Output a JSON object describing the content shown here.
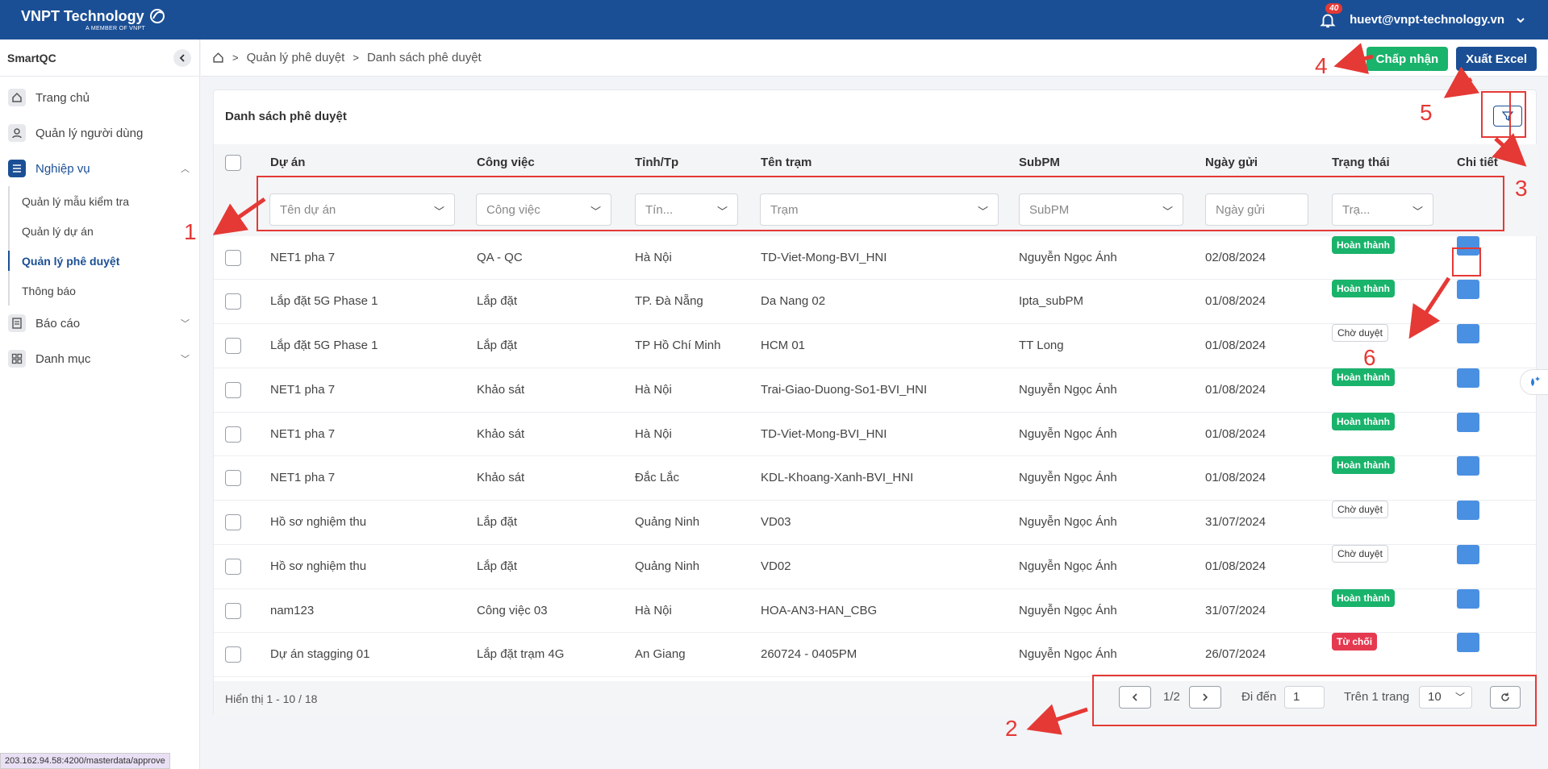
{
  "app": {
    "brand": "VNPT Technology",
    "brand_sub": "A MEMBER OF VNPT",
    "notifications": "40",
    "user_email": "huevt@vnpt-technology.vn"
  },
  "sidebar": {
    "title": "SmartQC",
    "items": [
      {
        "label": "Trang chủ",
        "icon": "home-icon"
      },
      {
        "label": "Quản lý người dùng",
        "icon": "user-icon"
      },
      {
        "label": "Nghiệp vụ",
        "icon": "list-icon"
      },
      {
        "label": "Báo cáo",
        "icon": "report-icon"
      },
      {
        "label": "Danh mục",
        "icon": "grid-icon"
      }
    ],
    "sub_items": [
      "Quản lý mẫu kiểm tra",
      "Quản lý dự án",
      "Quản lý phê duyệt",
      "Thông báo"
    ]
  },
  "breadcrumb": [
    "Quản lý phê duyệt",
    "Danh sách phê duyệt"
  ],
  "actions": {
    "accept": "Chấp nhận",
    "export": "Xuất Excel"
  },
  "panel": {
    "title": "Danh sách phê duyệt"
  },
  "table": {
    "headers": [
      "Dự án",
      "Công việc",
      "Tỉnh/Tp",
      "Tên trạm",
      "SubPM",
      "Ngày gửi",
      "Trạng thái",
      "Chi tiết"
    ],
    "filters": [
      "Tên dự án",
      "Công việc",
      "Tín...",
      "Trạm",
      "SubPM",
      "Ngày gửi",
      "Trạ..."
    ],
    "rows": [
      {
        "project": "NET1 pha 7",
        "task": "QA - QC",
        "province": "Hà Nội",
        "station": "TD-Viet-Mong-BVI_HNI",
        "subpm": "Nguyễn Ngọc Ánh",
        "date": "02/08/2024",
        "status": "Hoàn thành",
        "status_type": "done"
      },
      {
        "project": "Lắp đặt 5G Phase 1",
        "task": "Lắp đặt",
        "province": "TP. Đà Nẵng",
        "station": "Da Nang 02",
        "subpm": "Ipta_subPM",
        "date": "01/08/2024",
        "status": "Hoàn thành",
        "status_type": "done"
      },
      {
        "project": "Lắp đặt 5G Phase 1",
        "task": "Lắp đặt",
        "province": "TP Hồ Chí Minh",
        "station": "HCM 01",
        "subpm": "TT Long",
        "date": "01/08/2024",
        "status": "Chờ duyệt",
        "status_type": "wait"
      },
      {
        "project": "NET1 pha 7",
        "task": "Khảo sát",
        "province": "Hà Nội",
        "station": "Trai-Giao-Duong-So1-BVI_HNI",
        "subpm": "Nguyễn Ngọc Ánh",
        "date": "01/08/2024",
        "status": "Hoàn thành",
        "status_type": "done"
      },
      {
        "project": "NET1 pha 7",
        "task": "Khảo sát",
        "province": "Hà Nội",
        "station": "TD-Viet-Mong-BVI_HNI",
        "subpm": "Nguyễn Ngọc Ánh",
        "date": "01/08/2024",
        "status": "Hoàn thành",
        "status_type": "done"
      },
      {
        "project": "NET1 pha 7",
        "task": "Khảo sát",
        "province": "Đắc Lắc",
        "station": "KDL-Khoang-Xanh-BVI_HNI",
        "subpm": "Nguyễn Ngọc Ánh",
        "date": "01/08/2024",
        "status": "Hoàn thành",
        "status_type": "done"
      },
      {
        "project": "Hồ sơ nghiệm thu",
        "task": "Lắp đặt",
        "province": "Quảng Ninh",
        "station": "VD03",
        "subpm": "Nguyễn Ngọc Ánh",
        "date": "31/07/2024",
        "status": "Chờ duyệt",
        "status_type": "wait"
      },
      {
        "project": "Hồ sơ nghiệm thu",
        "task": "Lắp đặt",
        "province": "Quảng Ninh",
        "station": "VD02",
        "subpm": "Nguyễn Ngọc Ánh",
        "date": "01/08/2024",
        "status": "Chờ duyệt",
        "status_type": "wait"
      },
      {
        "project": "nam123",
        "task": "Công việc 03",
        "province": "Hà Nội",
        "station": "HOA-AN3-HAN_CBG",
        "subpm": "Nguyễn Ngọc Ánh",
        "date": "31/07/2024",
        "status": "Hoàn thành",
        "status_type": "done"
      },
      {
        "project": "Dự án stagging 01",
        "task": "Lắp đặt trạm 4G",
        "province": "An Giang",
        "station": "260724 - 0405PM",
        "subpm": "Nguyễn Ngọc Ánh",
        "date": "26/07/2024",
        "status": "Từ chối",
        "status_type": "rej"
      }
    ]
  },
  "footer": {
    "info": "Hiển thị 1 - 10 / 18",
    "page": "1/2",
    "goto_label": "Đi đến",
    "goto_value": "1",
    "per_page_label": "Trên 1 trang",
    "per_page_value": "10"
  },
  "annotations": [
    "1",
    "2",
    "3",
    "4",
    "5",
    "6"
  ],
  "status_url": "203.162.94.58:4200/masterdata/approve",
  "colors": {
    "primary": "#1b4f95",
    "success": "#19b36b",
    "danger": "#e53950",
    "annotation": "#e53935"
  }
}
